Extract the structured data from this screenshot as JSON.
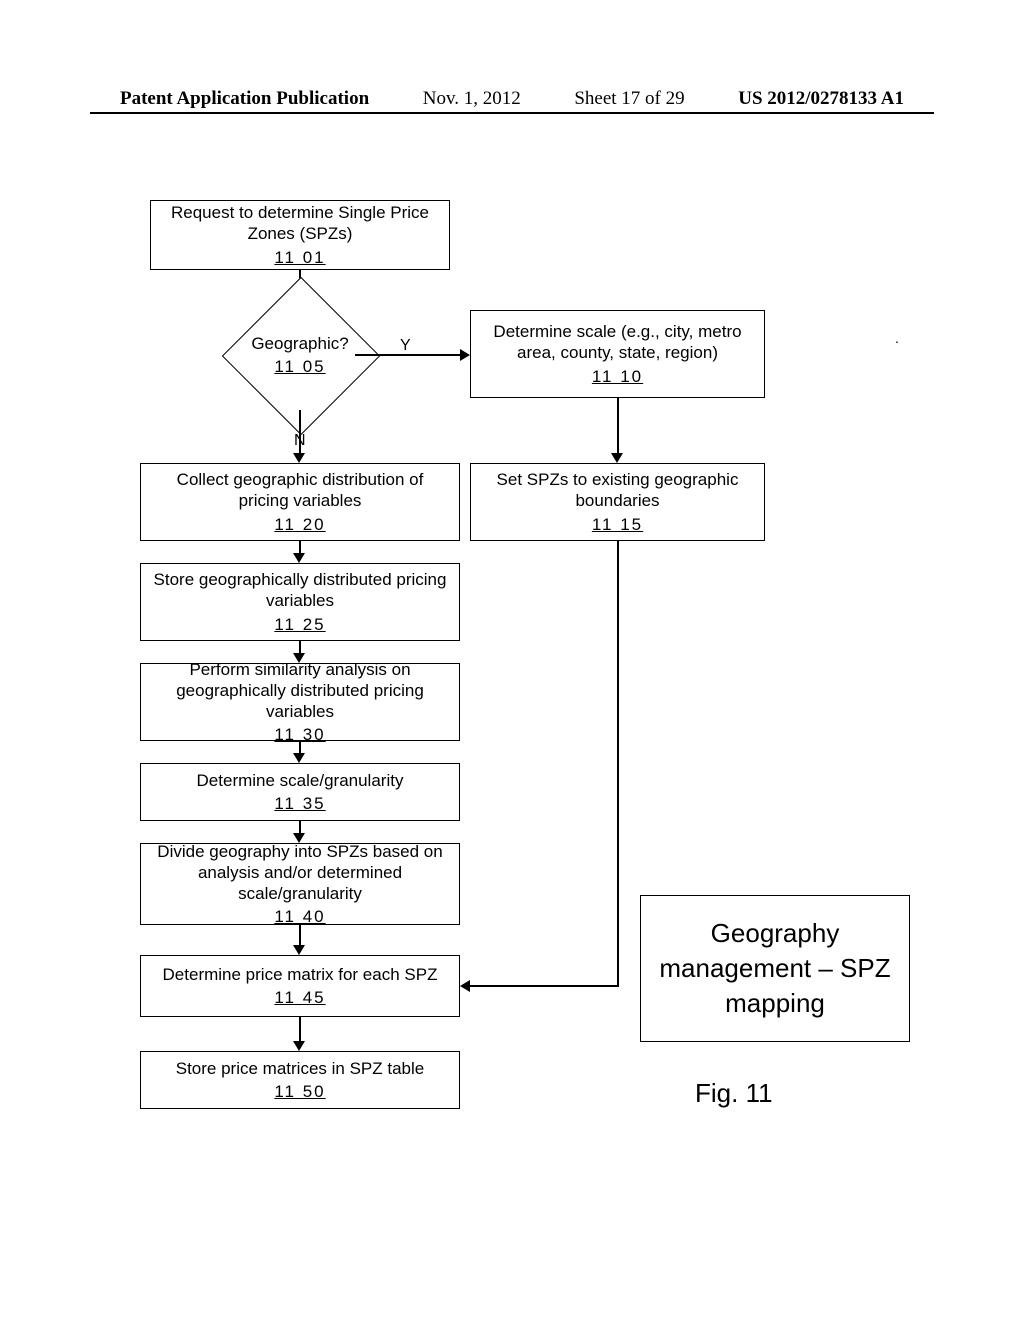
{
  "header": {
    "left": "Patent Application Publication",
    "date": "Nov. 1, 2012",
    "sheet": "Sheet 17 of 29",
    "pubno": "US 2012/0278133 A1"
  },
  "flowchart": {
    "b1101": {
      "text": "Request to determine Single Price Zones (SPZs)",
      "ref": "11 01"
    },
    "b1105": {
      "text": "Geographic?",
      "ref": "11 05"
    },
    "b1110": {
      "text": "Determine scale (e.g., city, metro area, county, state, region)",
      "ref": "11 10"
    },
    "b1115": {
      "text": "Set SPZs to existing geographic boundaries",
      "ref": "11 15"
    },
    "b1120": {
      "text": "Collect geographic distribution of pricing variables",
      "ref": "11 20"
    },
    "b1125": {
      "text": "Store geographically distributed pricing variables",
      "ref": "11 25"
    },
    "b1130": {
      "text": "Perform similarity analysis on geographically distributed pricing variables",
      "ref": "11 30"
    },
    "b1135": {
      "text": "Determine scale/granularity",
      "ref": "11 35"
    },
    "b1140": {
      "text": "Divide geography into SPZs based on analysis and/or determined scale/granularity",
      "ref": "11 40"
    },
    "b1145": {
      "text": "Determine price matrix for each SPZ",
      "ref": "11 45"
    },
    "b1150": {
      "text": "Store price matrices in SPZ table",
      "ref": "11 50"
    },
    "yes": "Y",
    "no": "N"
  },
  "title_box": "Geography management – SPZ mapping",
  "figure_label": "Fig. 11",
  "chart_data": {
    "type": "flowchart",
    "title": "Geography management – SPZ mapping",
    "nodes": [
      {
        "id": "1101",
        "type": "process",
        "label": "Request to determine Single Price Zones (SPZs)"
      },
      {
        "id": "1105",
        "type": "decision",
        "label": "Geographic?"
      },
      {
        "id": "1110",
        "type": "process",
        "label": "Determine scale (e.g., city, metro area, county, state, region)"
      },
      {
        "id": "1115",
        "type": "process",
        "label": "Set SPZs to existing geographic boundaries"
      },
      {
        "id": "1120",
        "type": "process",
        "label": "Collect geographic distribution of pricing variables"
      },
      {
        "id": "1125",
        "type": "process",
        "label": "Store geographically distributed pricing variables"
      },
      {
        "id": "1130",
        "type": "process",
        "label": "Perform similarity analysis on geographically distributed pricing variables"
      },
      {
        "id": "1135",
        "type": "process",
        "label": "Determine scale/granularity"
      },
      {
        "id": "1140",
        "type": "process",
        "label": "Divide geography into SPZs based on analysis and/or determined scale/granularity"
      },
      {
        "id": "1145",
        "type": "process",
        "label": "Determine price matrix for each SPZ"
      },
      {
        "id": "1150",
        "type": "process",
        "label": "Store price matrices in SPZ table"
      }
    ],
    "edges": [
      {
        "from": "1101",
        "to": "1105",
        "label": ""
      },
      {
        "from": "1105",
        "to": "1110",
        "label": "Y"
      },
      {
        "from": "1105",
        "to": "1120",
        "label": "N"
      },
      {
        "from": "1110",
        "to": "1115",
        "label": ""
      },
      {
        "from": "1115",
        "to": "1145",
        "label": ""
      },
      {
        "from": "1120",
        "to": "1125",
        "label": ""
      },
      {
        "from": "1125",
        "to": "1130",
        "label": ""
      },
      {
        "from": "1130",
        "to": "1135",
        "label": ""
      },
      {
        "from": "1135",
        "to": "1140",
        "label": ""
      },
      {
        "from": "1140",
        "to": "1145",
        "label": ""
      },
      {
        "from": "1145",
        "to": "1150",
        "label": ""
      }
    ]
  }
}
